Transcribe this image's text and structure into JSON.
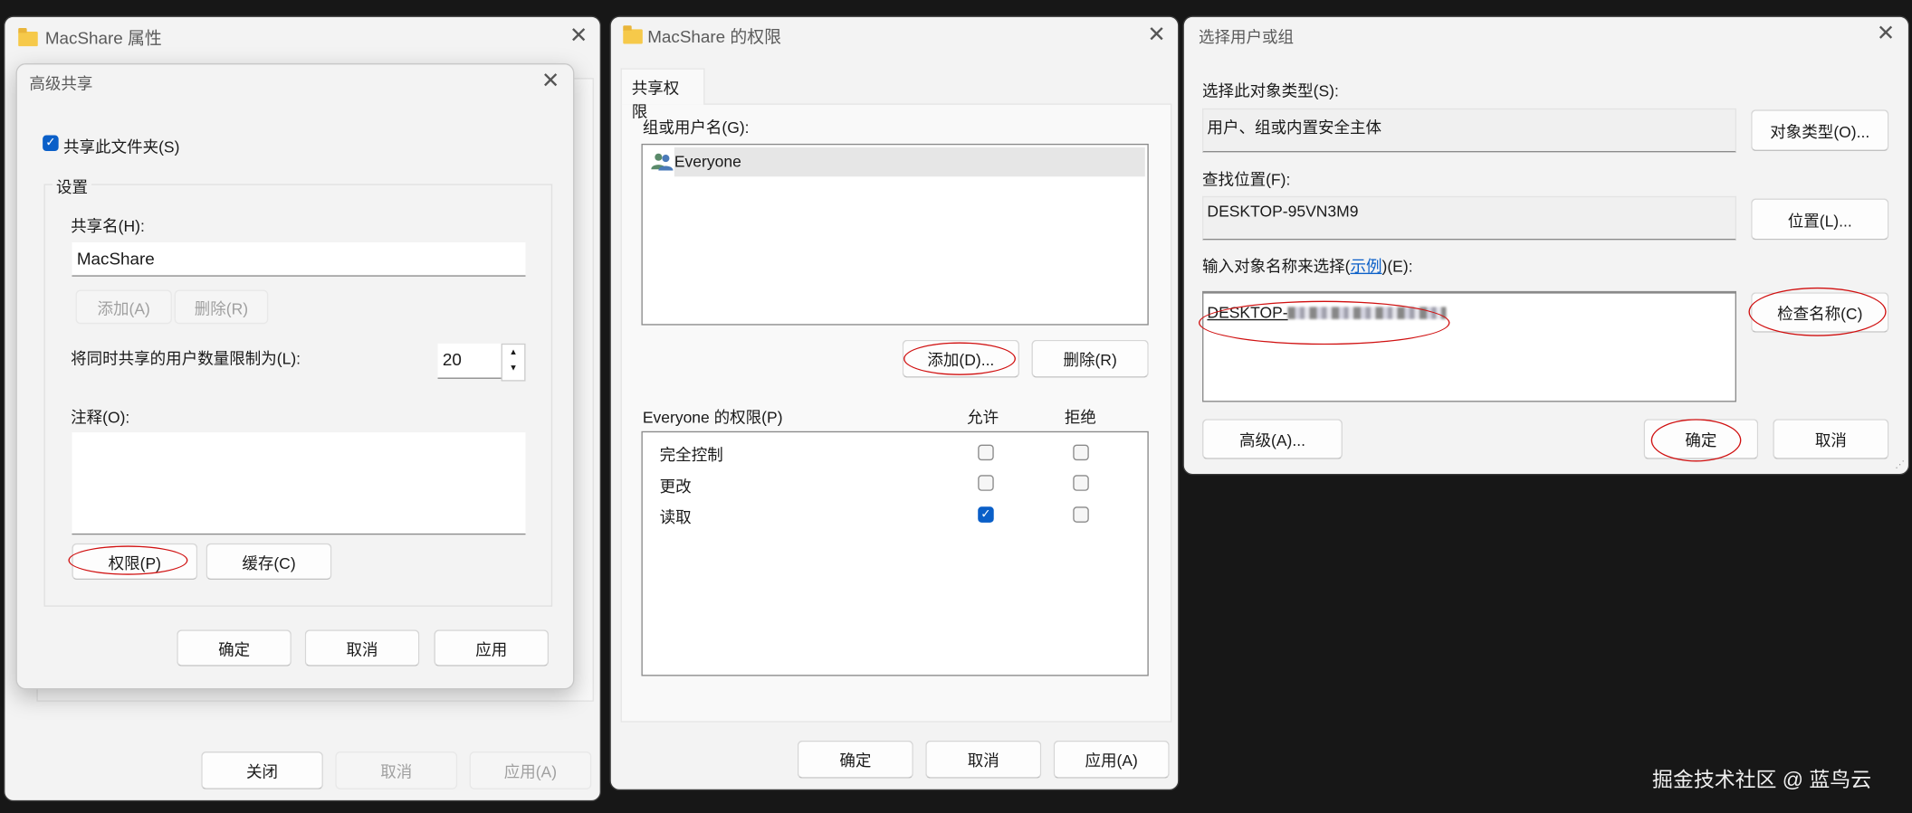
{
  "properties_window": {
    "title": "MacShare 属性",
    "footer": {
      "close": "关闭",
      "cancel": "取消",
      "apply": "应用(A)"
    }
  },
  "advanced_sharing": {
    "title": "高级共享",
    "share_checkbox_label": "共享此文件夹(S)",
    "share_checked": true,
    "group_label": "设置",
    "share_name_label": "共享名(H):",
    "share_name_value": "MacShare",
    "add_button": "添加(A)",
    "remove_button": "删除(R)",
    "limit_label": "将同时共享的用户数量限制为(L):",
    "limit_value": "20",
    "comment_label": "注释(O):",
    "comment_value": "",
    "permissions_button": "权限(P)",
    "caching_button": "缓存(C)",
    "ok": "确定",
    "cancel": "取消",
    "apply": "应用"
  },
  "permissions_window": {
    "title": "MacShare 的权限",
    "tab": "共享权限",
    "users_label": "组或用户名(G):",
    "users": [
      {
        "name": "Everyone",
        "icon": "user-group-icon"
      }
    ],
    "add_button": "添加(D)...",
    "remove_button": "删除(R)",
    "perm_header": "Everyone 的权限(P)",
    "allow_header": "允许",
    "deny_header": "拒绝",
    "permissions": [
      {
        "name": "完全控制",
        "allow": false,
        "deny": false
      },
      {
        "name": "更改",
        "allow": false,
        "deny": false
      },
      {
        "name": "读取",
        "allow": true,
        "deny": false
      }
    ],
    "ok": "确定",
    "cancel": "取消",
    "apply": "应用(A)"
  },
  "select_user_window": {
    "title": "选择用户或组",
    "object_type_label": "选择此对象类型(S):",
    "object_type_value": "用户、组或内置安全主体",
    "object_type_button": "对象类型(O)...",
    "location_label": "查找位置(F):",
    "location_value": "DESKTOP-95VN3M9",
    "location_button": "位置(L)...",
    "enter_label_prefix": "输入对象名称来选择(",
    "enter_label_link": "示例",
    "enter_label_suffix": ")(E):",
    "enter_value": "DESKTOP-",
    "check_names_button": "检查名称(C)",
    "advanced_button": "高级(A)...",
    "ok": "确定",
    "cancel": "取消"
  },
  "watermark": "掘金技术社区 @ 蓝鸟云",
  "colors": {
    "accent": "#0a5fc8",
    "annotation": "#d01010",
    "background": "#171717"
  }
}
